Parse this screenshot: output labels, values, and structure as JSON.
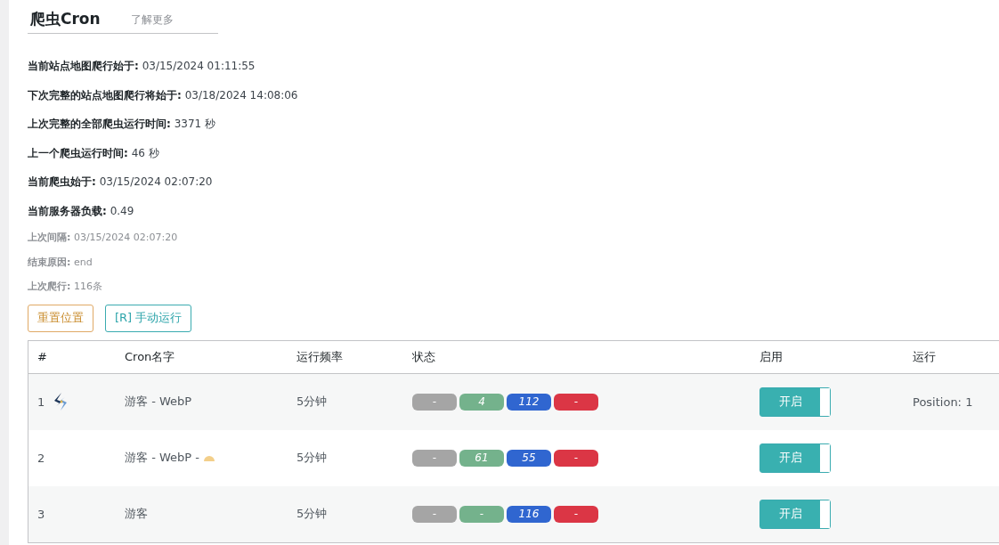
{
  "header": {
    "title": "爬虫Cron",
    "link": "了解更多"
  },
  "info": [
    {
      "label": "当前站点地图爬行始于:",
      "value": "03/15/2024 01:11:55",
      "muted": false
    },
    {
      "label": "下次完整的站点地图爬行将始于:",
      "value": "03/18/2024 14:08:06",
      "muted": false
    },
    {
      "label": "上次完整的全部爬虫运行时间:",
      "value": "3371 秒",
      "muted": false
    },
    {
      "label": "上一个爬虫运行时间:",
      "value": "46 秒",
      "muted": false
    },
    {
      "label": "当前爬虫始于:",
      "value": "03/15/2024 02:07:20",
      "muted": false
    },
    {
      "label": "当前服务器负载:",
      "value": "0.49",
      "muted": false
    },
    {
      "label": "上次间隔:",
      "value": "03/15/2024 02:07:20",
      "muted": true
    },
    {
      "label": "结束原因:",
      "value": "end",
      "muted": true
    },
    {
      "label": "上次爬行:",
      "value": "116条",
      "muted": true
    }
  ],
  "buttons": [
    {
      "label": "重置位置",
      "kind": "warning"
    },
    {
      "label": "[R] 手动运行",
      "kind": "info"
    }
  ],
  "table": {
    "columns": [
      "#",
      "Cron名字",
      "运行频率",
      "状态",
      "启用",
      "运行"
    ],
    "rows": [
      {
        "index": "1",
        "kind": "logo",
        "name": "游客 - WebP",
        "frequency": "5分钟",
        "status": [
          {
            "text": "-",
            "color": "#a5a5a5"
          },
          {
            "text": "4",
            "color": "#74b28c"
          },
          {
            "text": "112",
            "color": "#3066d0"
          },
          {
            "text": "-",
            "color": "#db3645"
          }
        ],
        "toggle": {
          "label": "开启",
          "on": true
        },
        "run": "Position: 1"
      },
      {
        "index": "2",
        "kind": "emoji",
        "name": "游客 - WebP -",
        "frequency": "5分钟",
        "status": [
          {
            "text": "-",
            "color": "#a5a5a5"
          },
          {
            "text": "61",
            "color": "#74b28c"
          },
          {
            "text": "55",
            "color": "#3066d0"
          },
          {
            "text": "-",
            "color": "#db3645"
          }
        ],
        "toggle": {
          "label": "开启",
          "on": true
        }
      },
      {
        "index": "3",
        "kind": "plain",
        "name": "游客",
        "frequency": "5分钟",
        "status": [
          {
            "text": "-",
            "color": "#a5a5a5"
          },
          {
            "text": "-",
            "color": "#74b28c"
          },
          {
            "text": "116",
            "color": "#3066d0"
          },
          {
            "text": "-",
            "color": "#db3645"
          }
        ],
        "toggle": {
          "label": "开启",
          "on": true
        }
      }
    ]
  }
}
